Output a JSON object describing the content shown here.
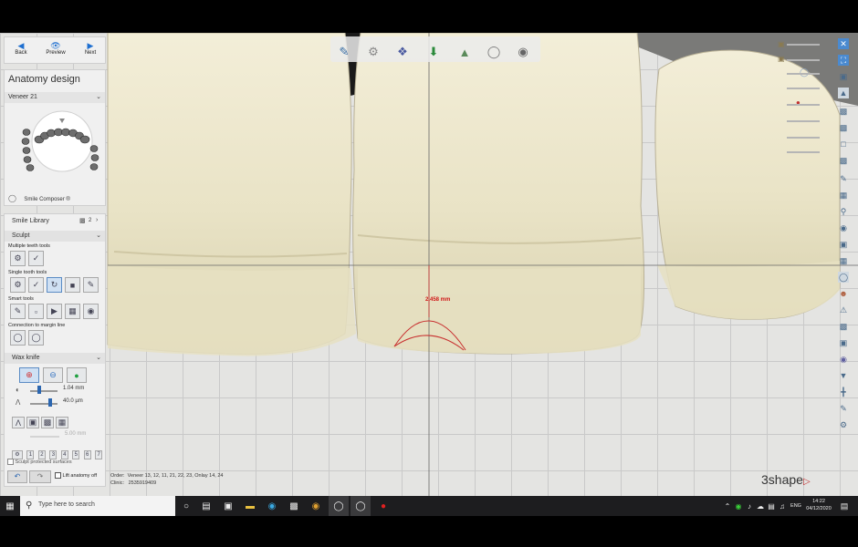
{
  "nav": {
    "back": "Back",
    "preview": "Preview",
    "next": "Next"
  },
  "panel": {
    "title": "Anatomy design",
    "tooth_select": "Veneer 21",
    "smile_composer": "Smile Composer ®",
    "smile_library": "Smile Library",
    "smile_library_count": "2",
    "sculpt": "Sculpt",
    "multiple_tools": "Multiple teeth tools",
    "single_tools": "Single tooth tools",
    "smart_tools": "Smart tools",
    "connection_margin": "Connection to margin line",
    "wax_knife": "Wax knife",
    "size_value": "1.04 mm",
    "strength_value": "40.0 µm",
    "disabled_value": "5.00 mm",
    "digits": [
      "1",
      "2",
      "3",
      "4",
      "5",
      "6",
      "7"
    ],
    "sculpt_protected": "Sculpt protected surfaces",
    "lift_anatomy": "Lift anatomy off"
  },
  "measurement": "2.458 mm",
  "order": {
    "order_label": "Order:",
    "order_value": "Veneer 13, 12, 11, 21, 22, 23, Onlay 14, 24",
    "clinic_label": "Clinic:",
    "clinic_value": "2535919409"
  },
  "logo": "3shape",
  "taskbar": {
    "search_placeholder": "Type here to search",
    "language": "ENG",
    "time": "14:22",
    "date": "04/12/2020"
  },
  "colors": {
    "accent": "#1e6fd0",
    "tooth": "#ece7cf",
    "record": "#e02020"
  }
}
